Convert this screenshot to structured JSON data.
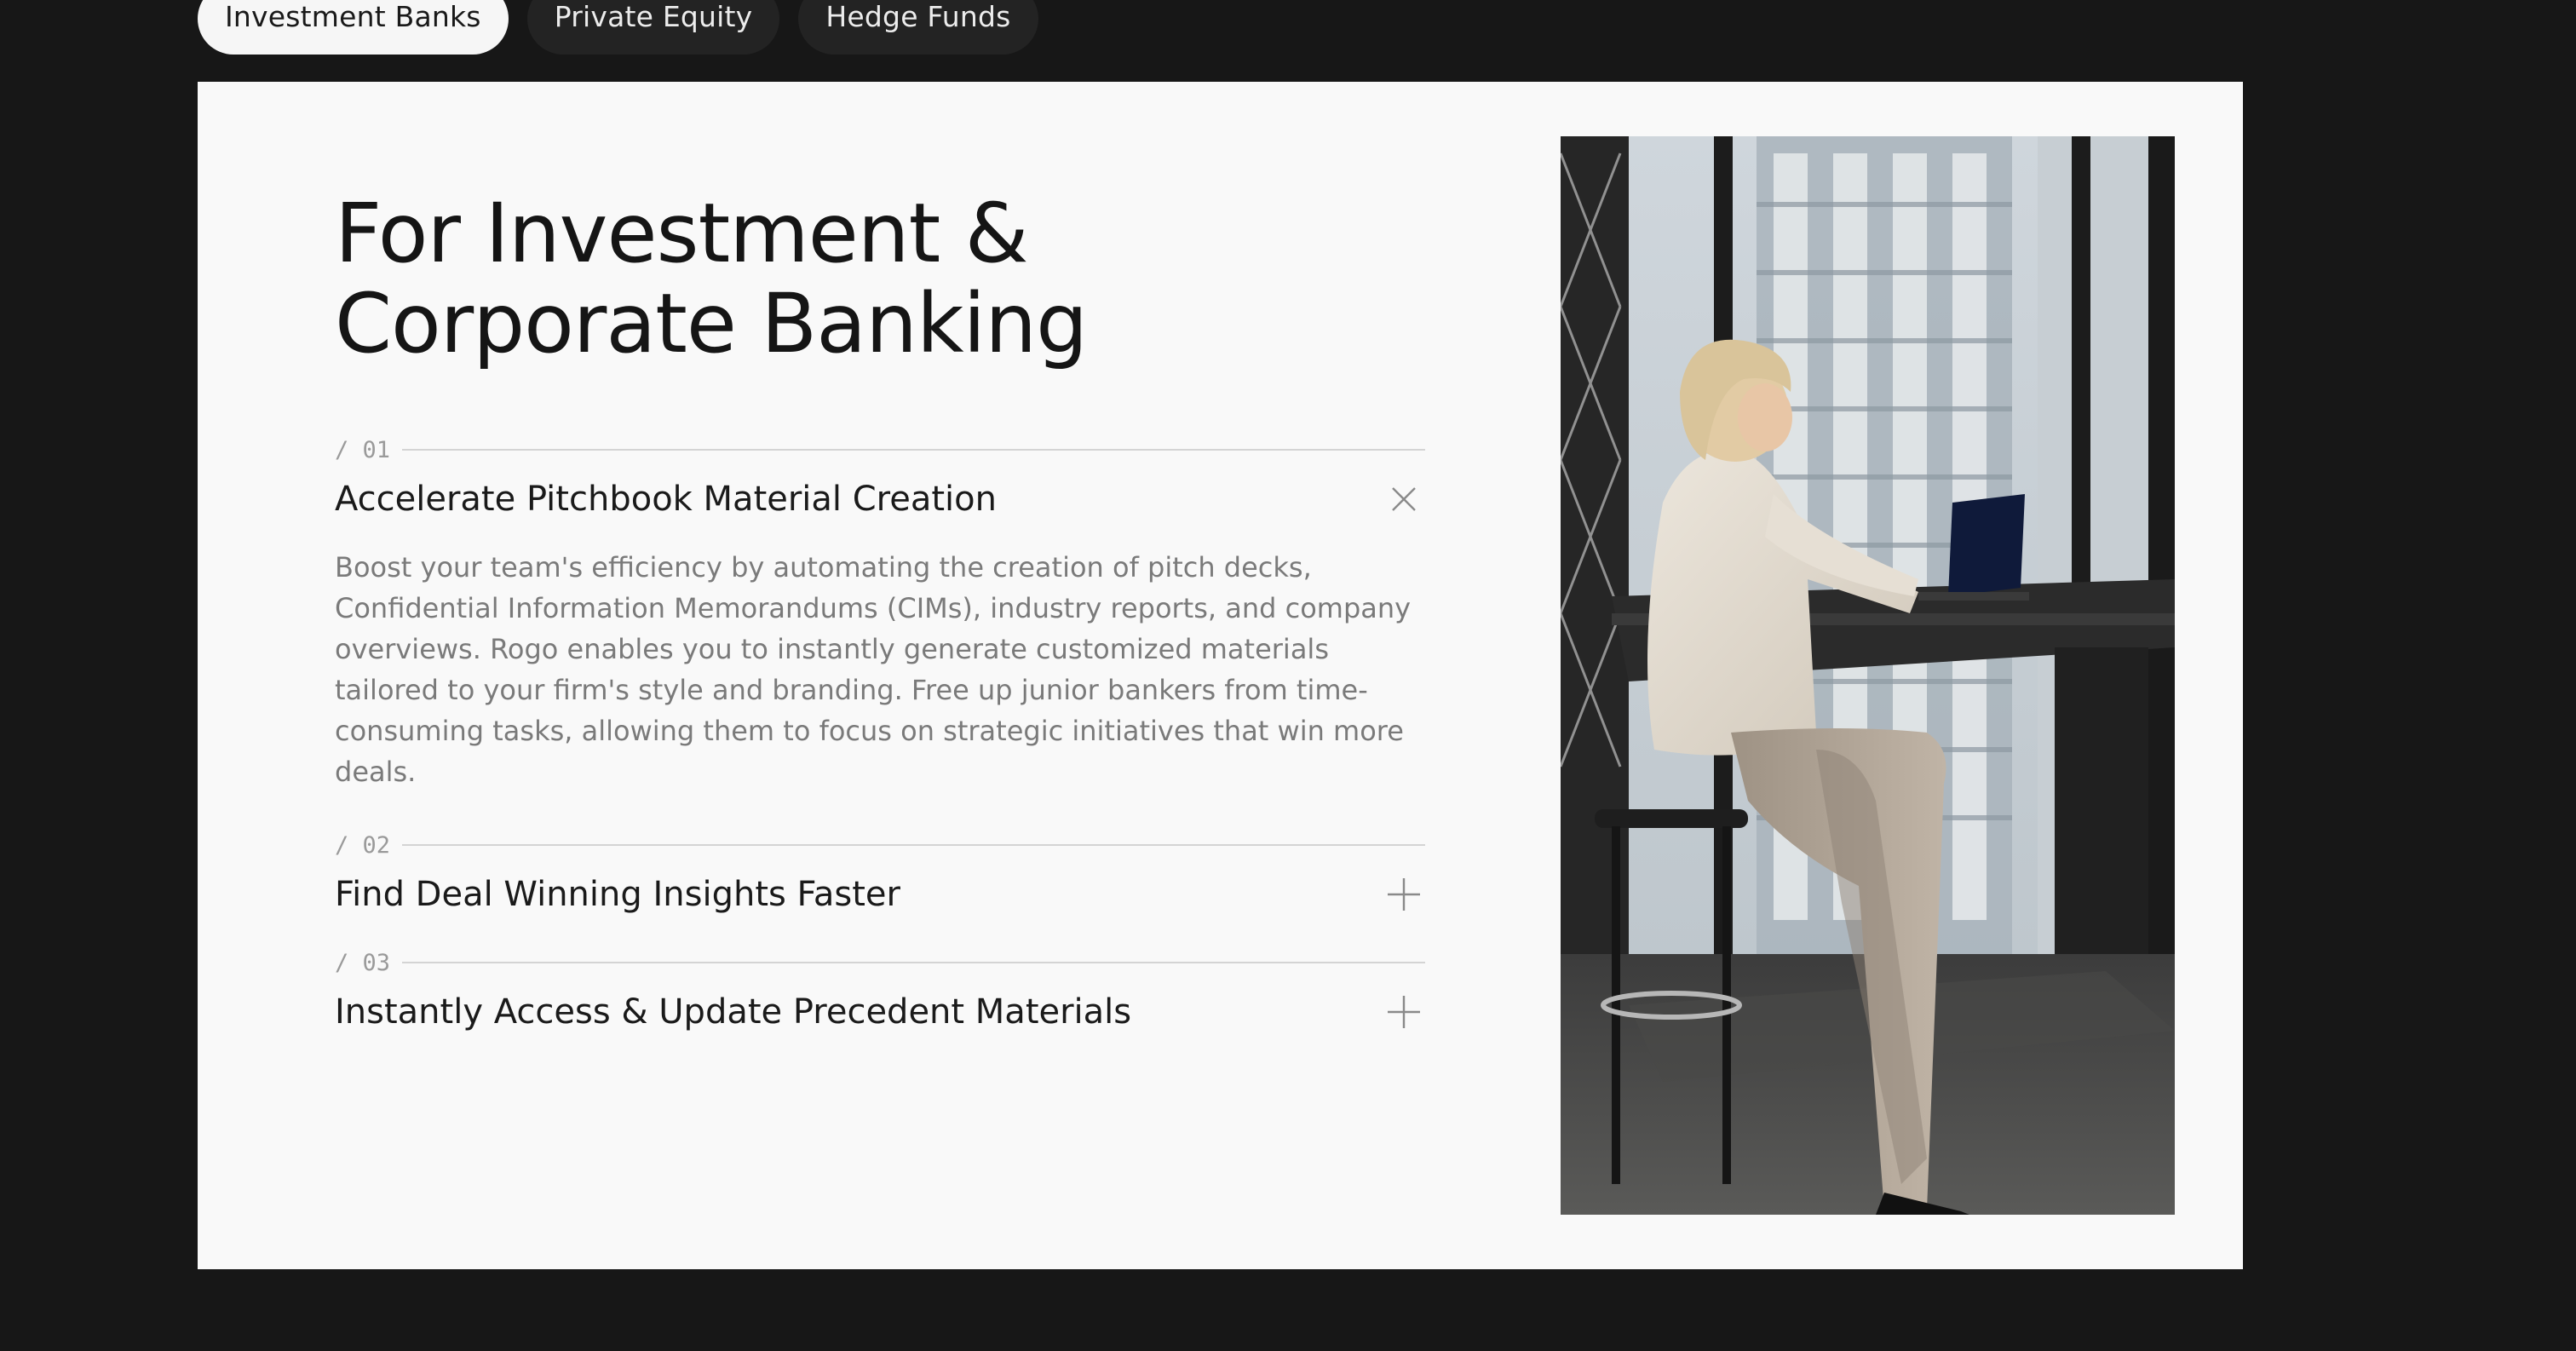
{
  "tabs": [
    {
      "label": "Investment Banks",
      "active": true
    },
    {
      "label": "Private Equity",
      "active": false
    },
    {
      "label": "Hedge Funds",
      "active": false
    }
  ],
  "heading": {
    "line1": "For Investment &",
    "line2": "Corporate Banking"
  },
  "accordion": [
    {
      "index": "/ 01",
      "title": "Accelerate Pitchbook Material Creation",
      "icon": "close-icon",
      "expanded": true,
      "body": "Boost your team's efficiency by automating the creation of pitch decks, Confidential Information Memorandums (CIMs), industry reports, and company overviews. Rogo enables you to instantly generate customized materials tailored to your firm's style and branding. Free up junior bankers from time-consuming tasks, allowing them to focus on strategic initiatives that win more deals."
    },
    {
      "index": "/ 02",
      "title": "Find Deal Winning Insights Faster",
      "icon": "plus-icon",
      "expanded": false
    },
    {
      "index": "/ 03",
      "title": "Instantly Access & Update Precedent Materials",
      "icon": "plus-icon",
      "expanded": false
    }
  ],
  "colors": {
    "page_background": "#171717",
    "card_background": "#f9f9f9",
    "active_tab": "#f6f6f6",
    "inactive_tab": "#232323"
  }
}
